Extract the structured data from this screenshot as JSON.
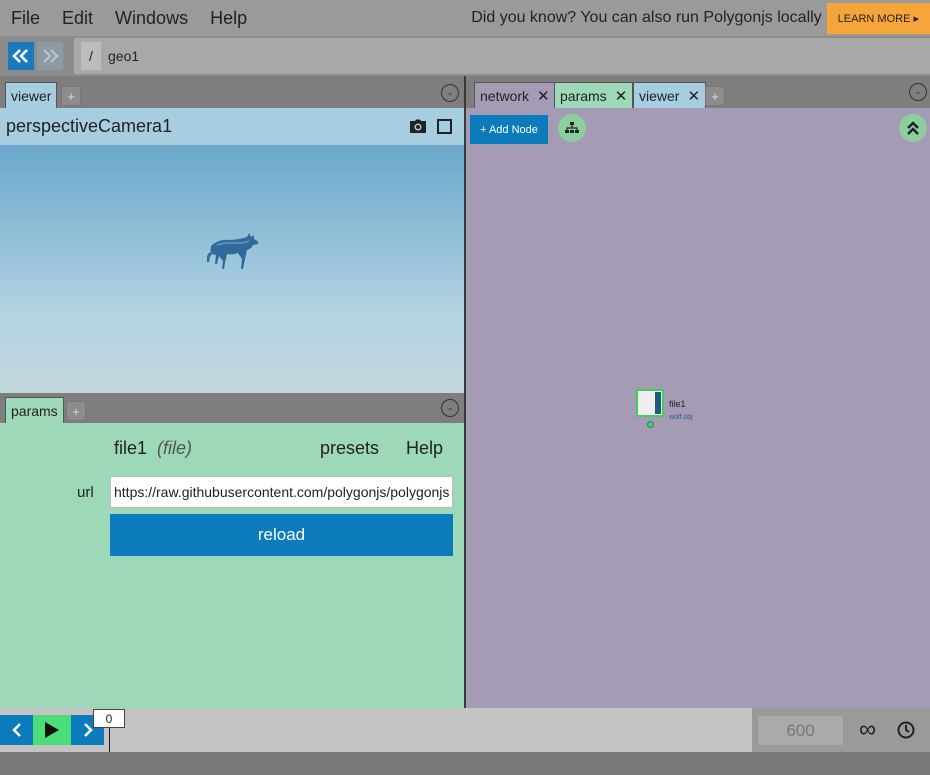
{
  "menu": {
    "items": [
      "File",
      "Edit",
      "Windows",
      "Help"
    ],
    "tip": "Did you know? You can also run Polygonjs locally",
    "learn_more": "LEARN MORE ▸"
  },
  "nav": {
    "root": "/",
    "path": "geo1"
  },
  "viewer_panel": {
    "tab": "viewer",
    "add": "+",
    "collapse": "-",
    "camera": "perspectiveCamera1"
  },
  "params_panel": {
    "tab": "params",
    "add": "+",
    "collapse": "-",
    "node_name": "file1",
    "node_type": "(file)",
    "presets": "presets",
    "help": "Help",
    "url_label": "url",
    "url_value": "https://raw.githubusercontent.com/polygonjs/polygonjs",
    "reload": "reload"
  },
  "network_panel": {
    "tabs": [
      "network",
      "params",
      "viewer"
    ],
    "add": "+",
    "collapse": "-",
    "add_node": "+ Add Node",
    "node": {
      "name": "file1",
      "file": "wolf.obj"
    }
  },
  "timeline": {
    "current_frame": "0",
    "end_frame": "600",
    "loop": "∞"
  },
  "colors": {
    "accent": "#0b7bbb",
    "params_bg": "#9dd9b8",
    "network_bg": "#a69bb4",
    "learn_more": "#f6a53a"
  }
}
